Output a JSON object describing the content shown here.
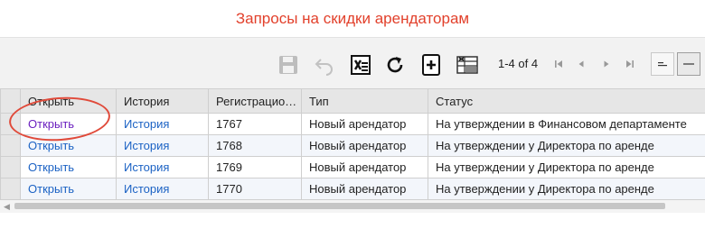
{
  "page_title": "Запросы на скидки арендаторам",
  "pager": {
    "text": "1-4 of 4"
  },
  "toolbar": {
    "icons": [
      "save-icon",
      "undo-icon",
      "export-excel-icon",
      "refresh-icon",
      "add-document-icon",
      "column-settings-icon"
    ],
    "nav": [
      "first-page-icon",
      "prev-page-icon",
      "next-page-icon",
      "last-page-icon"
    ],
    "views": [
      "list-view-icon",
      "grid-view-icon"
    ]
  },
  "table": {
    "columns": [
      "Открыть",
      "История",
      "Регистрацио…",
      "Тип",
      "Статус"
    ],
    "rows": [
      {
        "open": "Открыть",
        "history": "История",
        "reg": "1767",
        "type": "Новый арендатор",
        "status": "На утверждении в Финансовом департаменте",
        "visited": true
      },
      {
        "open": "Открыть",
        "history": "История",
        "reg": "1768",
        "type": "Новый арендатор",
        "status": "На утверждении у Директора по аренде",
        "visited": false
      },
      {
        "open": "Открыть",
        "history": "История",
        "reg": "1769",
        "type": "Новый арендатор",
        "status": "На утверждении у Директора по аренде",
        "visited": false
      },
      {
        "open": "Открыть",
        "history": "История",
        "reg": "1770",
        "type": "Новый арендатор",
        "status": "На утверждении у Директора по аренде",
        "visited": false
      }
    ]
  },
  "colors": {
    "title": "#e2402b",
    "link": "#1b62c4",
    "visited_link": "#6a1fbf",
    "annotation": "#e04a3a"
  }
}
